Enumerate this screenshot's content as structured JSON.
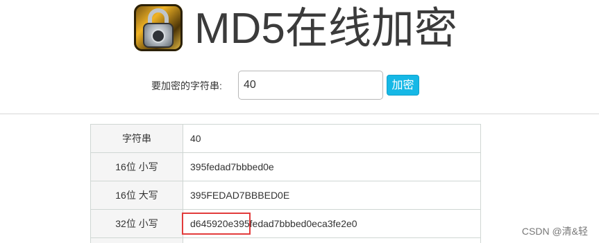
{
  "header": {
    "title": "MD5在线加密",
    "logo_icon": "padlock-icon"
  },
  "form": {
    "label": "要加密的字符串:",
    "input_value": "40",
    "button_label": "加密",
    "button_color": "#16b8e6"
  },
  "results": {
    "rows": [
      {
        "label": "字符串",
        "value": "40"
      },
      {
        "label": "16位 小写",
        "value": "395fedad7bbbed0e"
      },
      {
        "label": "16位 大写",
        "value": "395FEDAD7BBBED0E"
      },
      {
        "label": "32位 小写",
        "value": "d645920e395fedad7bbbed0eca3fe2e0"
      }
    ]
  },
  "annotation": {
    "highlight_color": "#e23b3b"
  },
  "watermark": "CSDN @清&轻"
}
